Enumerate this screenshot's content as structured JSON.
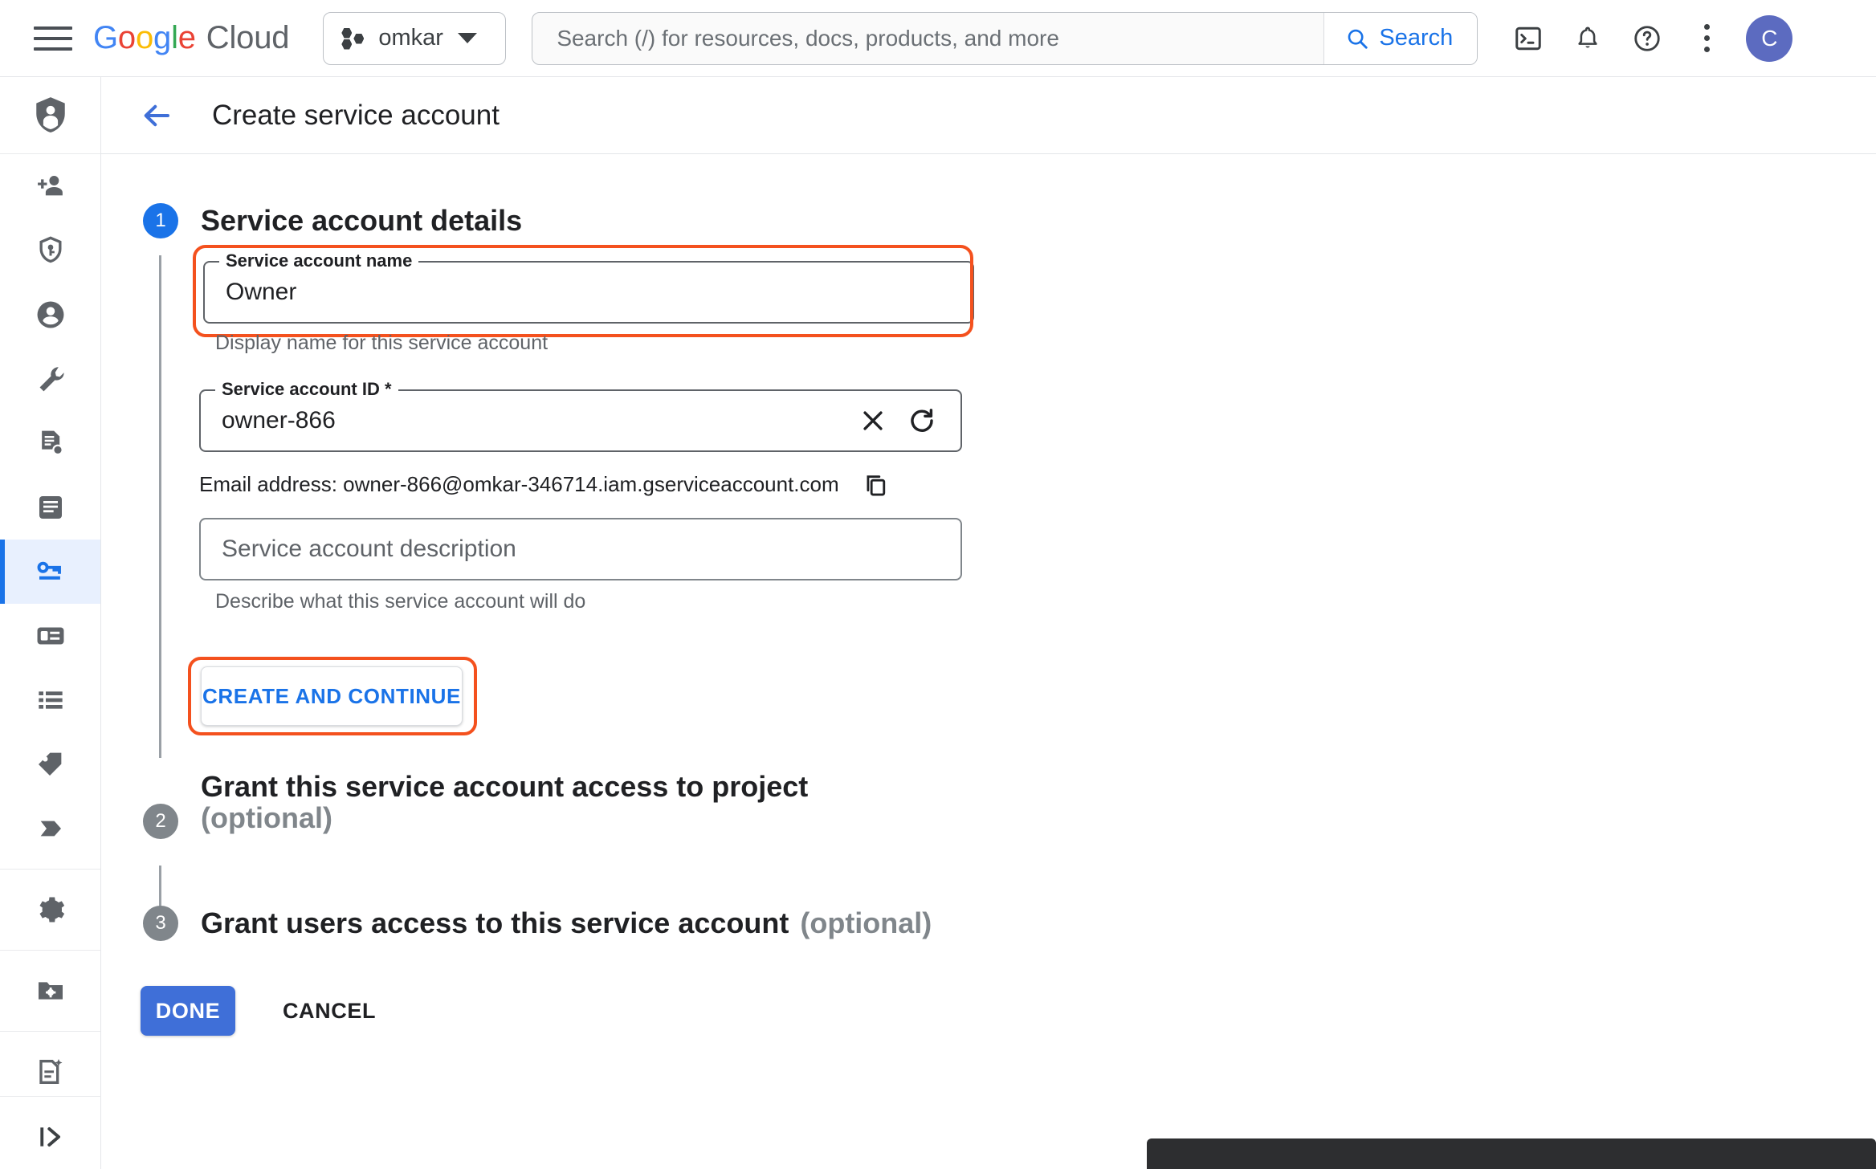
{
  "header": {
    "menu_label": "Main menu",
    "brand": {
      "g1": "G",
      "o1": "o",
      "o2": "o",
      "g2": "g",
      "l1": "l",
      "e1": "e",
      "cloud": "Cloud"
    },
    "project_selector": {
      "name": "omkar"
    },
    "search": {
      "placeholder": "Search (/) for resources, docs, products, and more",
      "value": "",
      "button_label": "Search"
    },
    "icons": {
      "cloud_shell": "cloud-shell-icon",
      "notifications": "notifications-bell-icon",
      "help": "help-circle-icon",
      "more": "more-vert-icon"
    },
    "avatar_initial": "C"
  },
  "sidebar": {
    "product_logo": "iam-shield-person-icon",
    "items": [
      {
        "name": "sidebar-item-grant-access",
        "icon": "person-add-icon"
      },
      {
        "name": "sidebar-item-policy-troubleshooter",
        "icon": "shield-key-icon"
      },
      {
        "name": "sidebar-item-identity",
        "icon": "account-circle-icon"
      },
      {
        "name": "sidebar-item-policy-tools",
        "icon": "wrench-icon"
      },
      {
        "name": "sidebar-item-org-policies",
        "icon": "document-policy-icon"
      },
      {
        "name": "sidebar-item-roles",
        "icon": "article-icon"
      },
      {
        "name": "sidebar-item-service-accounts",
        "icon": "key-card-icon",
        "selected": true
      },
      {
        "name": "sidebar-item-workload-identity",
        "icon": "badge-card-icon"
      },
      {
        "name": "sidebar-item-labels",
        "icon": "list-icon"
      },
      {
        "name": "sidebar-item-tags",
        "icon": "tag-icon"
      },
      {
        "name": "sidebar-item-privileged-access",
        "icon": "chevron-tag-icon"
      },
      {
        "name": "sidebar-item-settings",
        "icon": "gear-icon"
      },
      {
        "name": "sidebar-item-asset-inventory",
        "icon": "folder-settings-icon"
      },
      {
        "name": "sidebar-item-recommender",
        "icon": "document-sparkle-icon"
      }
    ],
    "expand_button": "expand-panel-icon"
  },
  "titlebar": {
    "back_icon": "arrow-back-icon",
    "title": "Create service account"
  },
  "steps": [
    {
      "number": "1",
      "title": "Service account details",
      "state": "active"
    },
    {
      "number": "2",
      "title": "Grant this service account access to project",
      "optional": "(optional)",
      "state": "inactive"
    },
    {
      "number": "3",
      "title": "Grant users access to this service account",
      "optional": "(optional)",
      "state": "inactive"
    }
  ],
  "form": {
    "name_field": {
      "label": "Service account name",
      "value": "Owner",
      "helper": "Display name for this service account",
      "highlighted": true
    },
    "id_field": {
      "label": "Service account ID *",
      "value": "owner-866",
      "clear_icon": "close-icon",
      "regenerate_icon": "refresh-icon"
    },
    "email_row": {
      "text": "Email address: owner-866@omkar-346714.iam.gserviceaccount.com",
      "copy_icon": "copy-icon"
    },
    "description_field": {
      "placeholder": "Service account description",
      "value": "",
      "helper": "Describe what this service account will do"
    },
    "create_continue_button": {
      "label": "CREATE AND CONTINUE",
      "highlighted": true
    }
  },
  "footer": {
    "done_label": "DONE",
    "cancel_label": "CANCEL"
  },
  "colors": {
    "accent_blue": "#1a73e8",
    "primary_button": "#3f6fd8",
    "annotation": "#f4511e",
    "step_active": "#1a73e8",
    "step_inactive": "#80868b",
    "muted_text": "#5f6368"
  }
}
